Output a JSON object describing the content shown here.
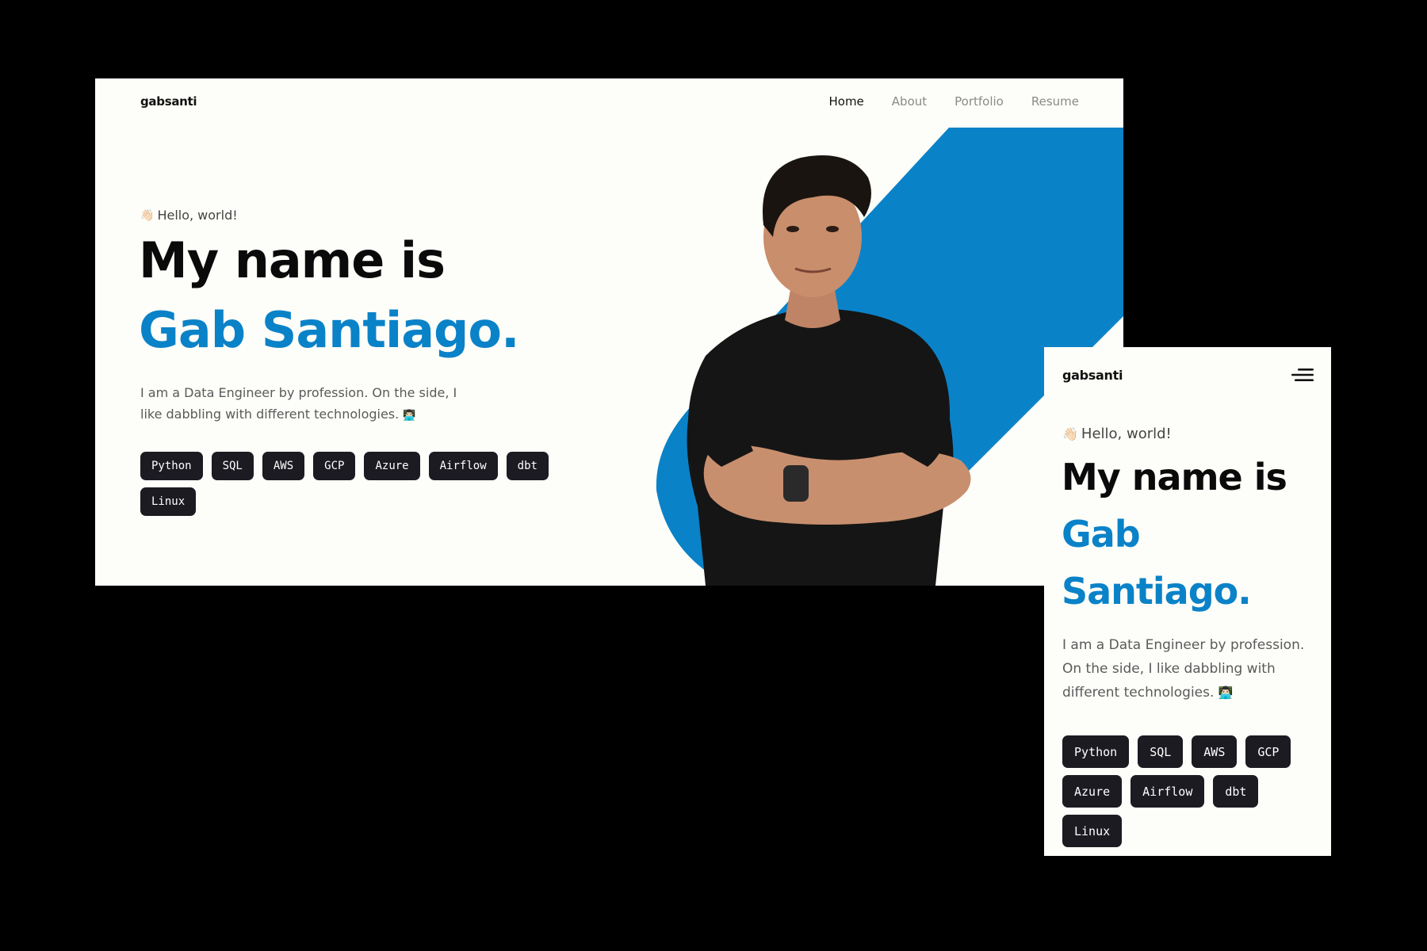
{
  "brand": "gabsanti",
  "nav": {
    "items": [
      {
        "label": "Home",
        "active": true
      },
      {
        "label": "About",
        "active": false
      },
      {
        "label": "Portfolio",
        "active": false
      },
      {
        "label": "Resume",
        "active": false
      }
    ]
  },
  "hero": {
    "greeting_icon": "👋🏻",
    "greeting": "Hello, world!",
    "line1": "My name is",
    "name": "Gab Santiago.",
    "name_first": "Gab",
    "name_last": "Santiago.",
    "bio": "I am a Data Engineer by profession. On the side, I like dabbling with different technologies.",
    "bio_icon": "👨🏻‍💻"
  },
  "tags": [
    "Python",
    "SQL",
    "AWS",
    "GCP",
    "Azure",
    "Airflow",
    "dbt",
    "Linux"
  ],
  "colors": {
    "accent": "#0a82c8",
    "tag_bg": "#1c1b22",
    "page_bg": "#fdfdf9",
    "backdrop": "#000000"
  },
  "icons": {
    "greeting": "waving-hand-icon",
    "bio": "technologist-icon",
    "menu": "hamburger-menu-icon"
  }
}
